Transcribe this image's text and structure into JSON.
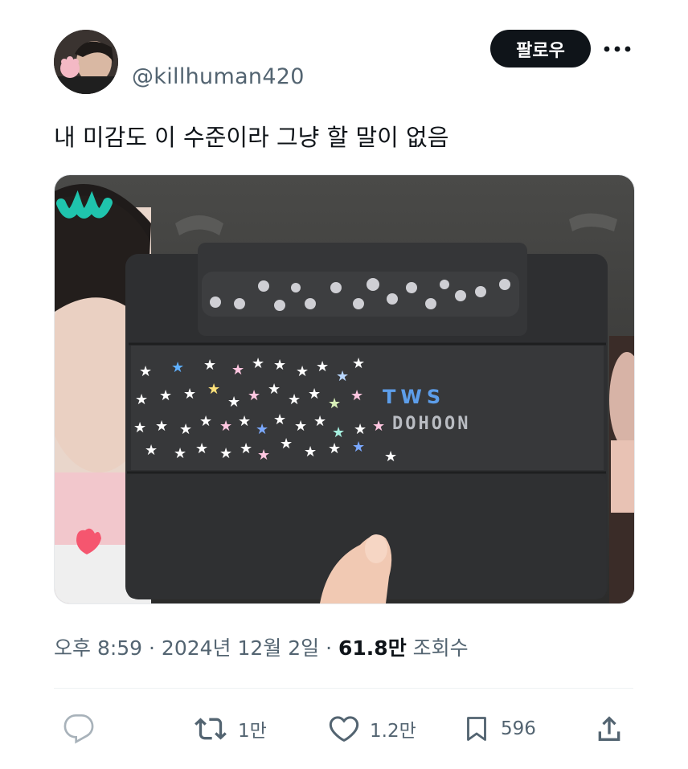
{
  "user": {
    "handle": "@killhuman420"
  },
  "header": {
    "follow_label": "팔로우"
  },
  "tweet": {
    "text": "내 미감도 이 수준이라 그냥 할 말이 없음"
  },
  "meta": {
    "time": "오후 8:59 · 2024년 12월 2일 · ",
    "views": "61.8만",
    "views_label": " 조회수"
  },
  "media": {
    "case_text_top": "TWS",
    "case_text_bottom": "DOHOON"
  },
  "actions": {
    "retweets": "1만",
    "likes": "1.2만",
    "bookmarks": "596"
  },
  "colors": {
    "accent": "#0f1419",
    "muted": "#536471"
  }
}
